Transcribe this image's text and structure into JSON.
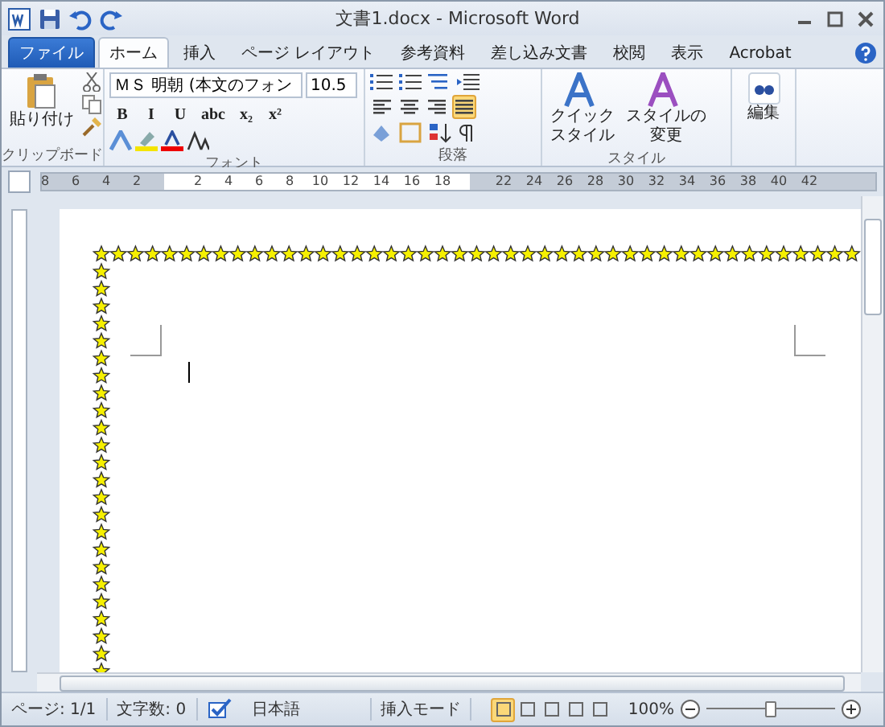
{
  "window": {
    "title": "文書1.docx - Microsoft Word"
  },
  "tabs": [
    {
      "label": "ファイル",
      "kind": "file",
      "selected": false
    },
    {
      "label": "ホーム",
      "kind": "tab",
      "selected": true
    },
    {
      "label": "挿入",
      "kind": "tab",
      "selected": false
    },
    {
      "label": "ページ レイアウト",
      "kind": "tab",
      "selected": false
    },
    {
      "label": "参考資料",
      "kind": "tab",
      "selected": false
    },
    {
      "label": "差し込み文書",
      "kind": "tab",
      "selected": false
    },
    {
      "label": "校閲",
      "kind": "tab",
      "selected": false
    },
    {
      "label": "表示",
      "kind": "tab",
      "selected": false
    },
    {
      "label": "Acrobat",
      "kind": "tab",
      "selected": false
    }
  ],
  "clipboard": {
    "paste": "貼り付け",
    "label": "クリップボード"
  },
  "font": {
    "name": "ＭＳ 明朝 (本文のフォン",
    "size": "10.5",
    "buttons": [
      "B",
      "I",
      "U",
      "abc",
      "x₂",
      "x²"
    ],
    "label": "フォント"
  },
  "paragraph": {
    "label": "段落",
    "aligns": [
      {
        "kind": "left",
        "selected": false
      },
      {
        "kind": "center",
        "selected": false
      },
      {
        "kind": "right",
        "selected": false
      },
      {
        "kind": "justify",
        "selected": true
      }
    ]
  },
  "styles": {
    "buttons": [
      [
        "クイック",
        "スタイル"
      ],
      [
        "スタイルの",
        "変更"
      ]
    ],
    "label": "スタイル"
  },
  "editing": {
    "label": "編集"
  },
  "ruler": {
    "numbers": [
      "8",
      "6",
      "4",
      "2",
      "2",
      "4",
      "6",
      "8",
      "10",
      "12",
      "14",
      "16",
      "18",
      "22",
      "24",
      "26",
      "28",
      "30",
      "32",
      "34",
      "36",
      "38",
      "40",
      "42"
    ]
  },
  "status_bar": {
    "page": "ページ: 1/1",
    "words": "文字数: 0",
    "language": "日本語",
    "mode": "挿入モード",
    "zoom": "100%",
    "level": 0.5,
    "views": [
      {
        "selected": true
      },
      {
        "selected": false
      },
      {
        "selected": false
      },
      {
        "selected": false
      },
      {
        "selected": false
      }
    ]
  }
}
